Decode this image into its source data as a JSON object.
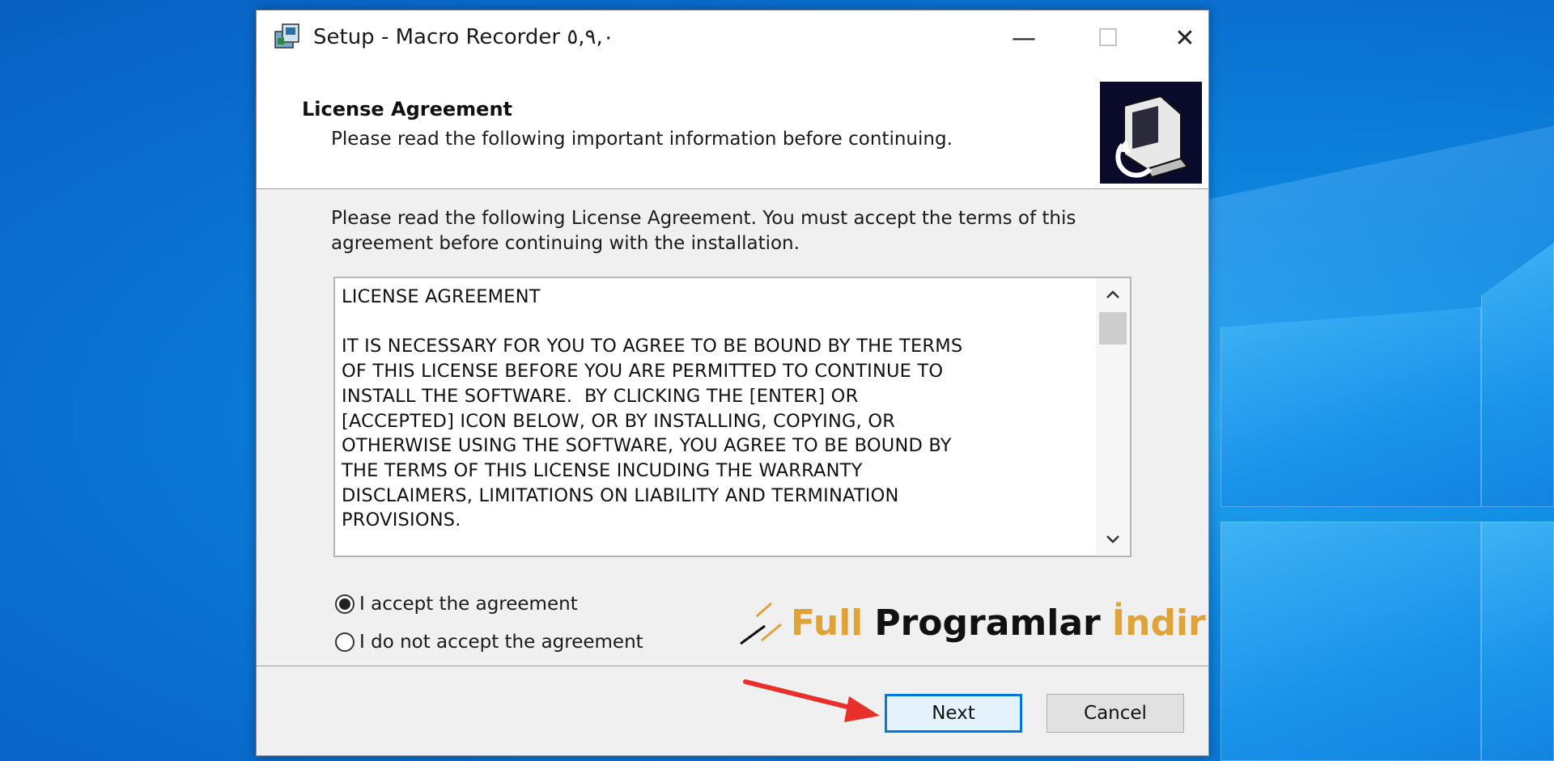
{
  "window": {
    "title": "Setup - Macro Recorder ٥,٩,٠",
    "controls": {
      "minimize": "—",
      "maximize": "☐",
      "close": "✕"
    }
  },
  "header": {
    "title": "License Agreement",
    "subtitle": "Please read the following important information before continuing."
  },
  "main": {
    "intro": "Please read the following License Agreement. You must accept the terms of this agreement before continuing with the installation.",
    "license_text": "LICENSE AGREEMENT\n\nIT IS NECESSARY FOR YOU TO AGREE TO BE BOUND BY THE TERMS\nOF THIS LICENSE BEFORE YOU ARE PERMITTED TO CONTINUE TO\nINSTALL THE SOFTWARE.  BY CLICKING THE [ENTER] OR\n[ACCEPTED] ICON BELOW, OR BY INSTALLING, COPYING, OR\nOTHERWISE USING THE SOFTWARE, YOU AGREE TO BE BOUND BY\nTHE TERMS OF THIS LICENSE INCUDING THE WARRANTY\nDISCLAIMERS, LIMITATIONS ON LIABILITY AND TERMINATION\nPROVISIONS.",
    "options": [
      {
        "label": "I accept the agreement",
        "selected": true
      },
      {
        "label": "I do not accept the agreement",
        "selected": false
      }
    ]
  },
  "watermark": {
    "part1": "Full",
    "part2": "Programlar",
    "part3": "İndir"
  },
  "footer": {
    "next_label": "Next",
    "cancel_label": "Cancel"
  },
  "colors": {
    "accent": "#0078d7",
    "watermark_gold": "#e0a33a",
    "arrow_red": "#e8302a"
  }
}
